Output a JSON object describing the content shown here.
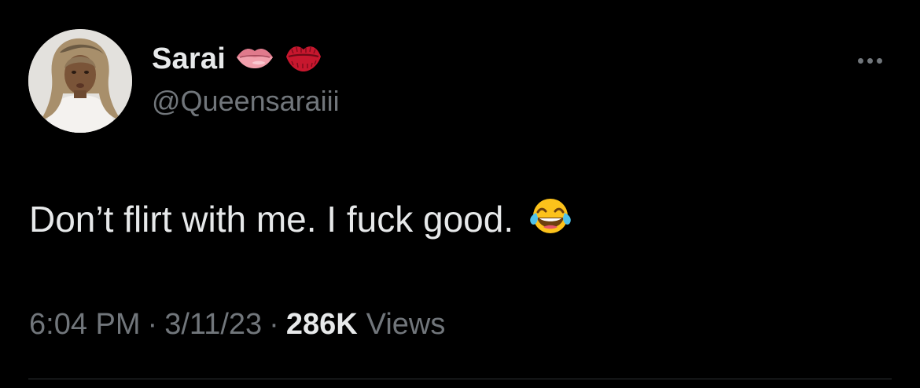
{
  "tweet": {
    "author": {
      "display_name": "Sarai",
      "handle": "@Queensaraiii",
      "name_emojis": [
        "lips-emoji-icon",
        "kiss-mark-emoji-icon"
      ]
    },
    "text": "Don’t flirt with me. I fuck good.",
    "text_emoji": "face-with-tears-of-joy-icon",
    "time": "6:04 PM",
    "separator": "·",
    "date": "3/11/23",
    "views_count": "286K",
    "views_label": "Views"
  },
  "colors": {
    "background": "#000000",
    "primary_text": "#e7e9ea",
    "secondary_text": "#71767b",
    "divider": "#2f3336"
  }
}
